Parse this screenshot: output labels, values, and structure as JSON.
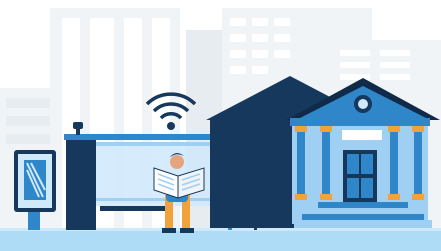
{
  "scene": {
    "palette": {
      "sky": "#ffffff",
      "building_light": "#f1f4f7",
      "building_mid": "#e7ecf1",
      "window": "#ffffff",
      "navy": "#16385d",
      "navy_dark": "#0f2b49",
      "blue": "#2f86c9",
      "blue_light": "#9fd0f3",
      "blue_pale": "#cfe9fb",
      "orange": "#f2a23a",
      "orange_dark": "#d8822a",
      "pavement": "#aedcf7",
      "skin": "#e6a47e"
    },
    "icons": {
      "wifi": "wifi-icon",
      "bus_sign": "bus-icon",
      "accessibility_sign": "wheelchair-icon",
      "ad_display": "advertising-display-icon",
      "camera": "security-camera-icon"
    }
  }
}
